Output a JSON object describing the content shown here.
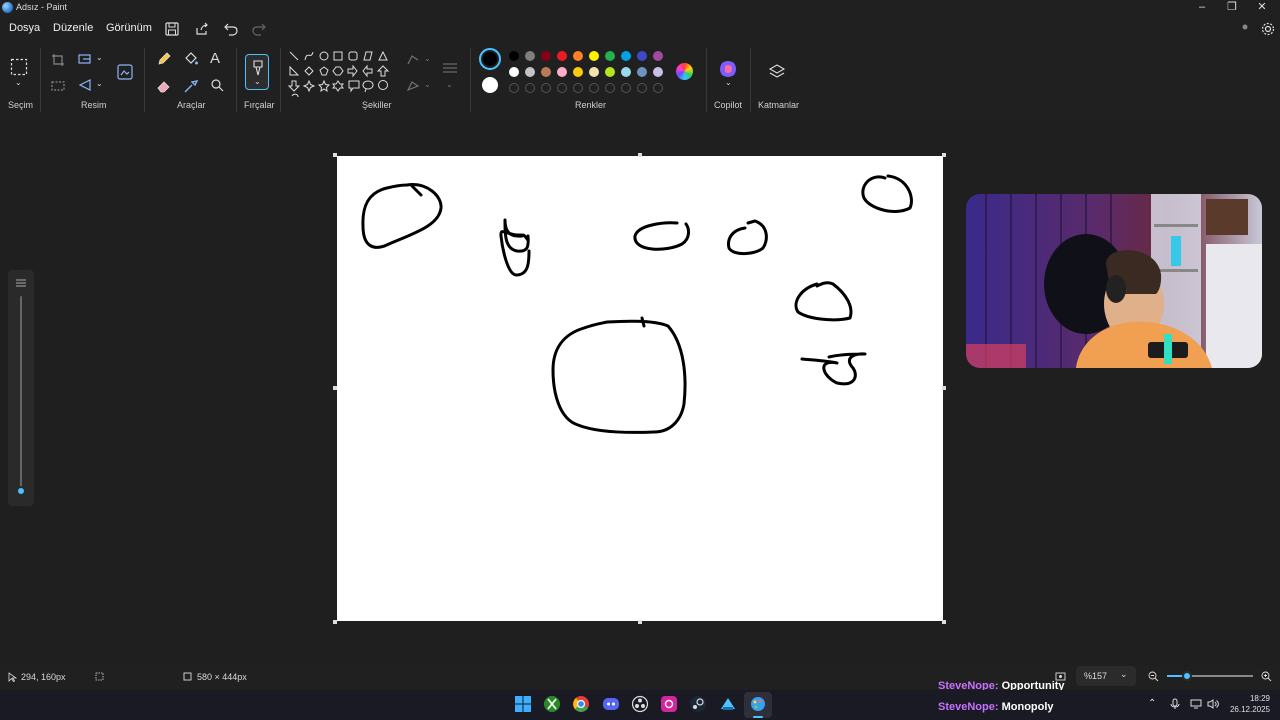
{
  "window": {
    "title": "Adsız - Paint"
  },
  "menu": {
    "file": "Dosya",
    "edit": "Düzenle",
    "view": "Görünüm"
  },
  "ribbon": {
    "selection": "Seçim",
    "image": "Resim",
    "tools": "Araçlar",
    "brushes": "Fırçalar",
    "shapes": "Şekiller",
    "colors": "Renkler",
    "copilot": "Copilot",
    "layers": "Katmanlar"
  },
  "palette": {
    "row1": [
      "#000000",
      "#7f7f7f",
      "#880015",
      "#ed1c24",
      "#ff7f27",
      "#fff200",
      "#22b14c",
      "#00a2e8",
      "#3f48cc",
      "#a349a4"
    ],
    "row2": [
      "#ffffff",
      "#c3c3c3",
      "#b97a57",
      "#ffaec9",
      "#ffc90e",
      "#efe4b0",
      "#b5e61d",
      "#99d9ea",
      "#7092be",
      "#c8bfe7"
    ],
    "primary": "#000000",
    "secondary": "#ffffff"
  },
  "status": {
    "cursor_position": "294, 160px",
    "canvas_size": "580 × 444px",
    "zoom": "%157"
  },
  "chat": [
    {
      "user": "SteveNope:",
      "message": "Opportunity"
    },
    {
      "user": "SteveNope:",
      "message": "Monopoly"
    }
  ],
  "clock": {
    "time": "18:29",
    "date": "26.12.2025"
  },
  "icons": {
    "save": "save-icon",
    "share": "share-icon",
    "undo": "undo-icon",
    "redo": "redo-icon",
    "settings": "gear-icon",
    "layers": "layers-icon",
    "copilot": "copilot-icon"
  }
}
